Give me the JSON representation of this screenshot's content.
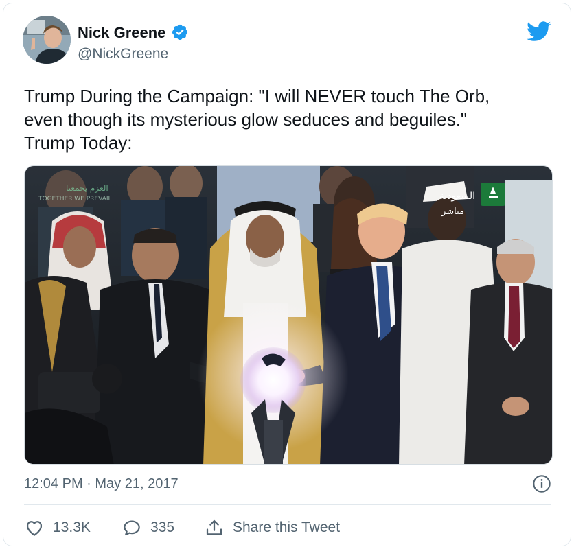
{
  "author": {
    "name": "Nick Greene",
    "handle": "@NickGreene",
    "verified": true
  },
  "tweet": {
    "lines": [
      "Trump During the Campaign: \"I will NEVER touch The Orb,",
      "even though its mysterious glow seduces and beguiles.\"",
      "Trump Today:"
    ]
  },
  "media": {
    "overlay_left_arabic": "العزم يجمعنا",
    "overlay_left_english": "TOGETHER WE PREVAIL",
    "overlay_right_channel": "السعودية",
    "overlay_right_live": "مباشر"
  },
  "meta": {
    "timestamp": "12:04 PM · May 21, 2017"
  },
  "actions": {
    "likes": "13.3K",
    "replies": "335",
    "share_label": "Share this Tweet"
  },
  "colors": {
    "brand_blue": "#1d9bf0",
    "secondary_text": "#536471"
  },
  "icons": [
    "verified-badge-icon",
    "twitter-bird-icon",
    "info-icon",
    "heart-icon",
    "reply-icon",
    "share-icon"
  ]
}
